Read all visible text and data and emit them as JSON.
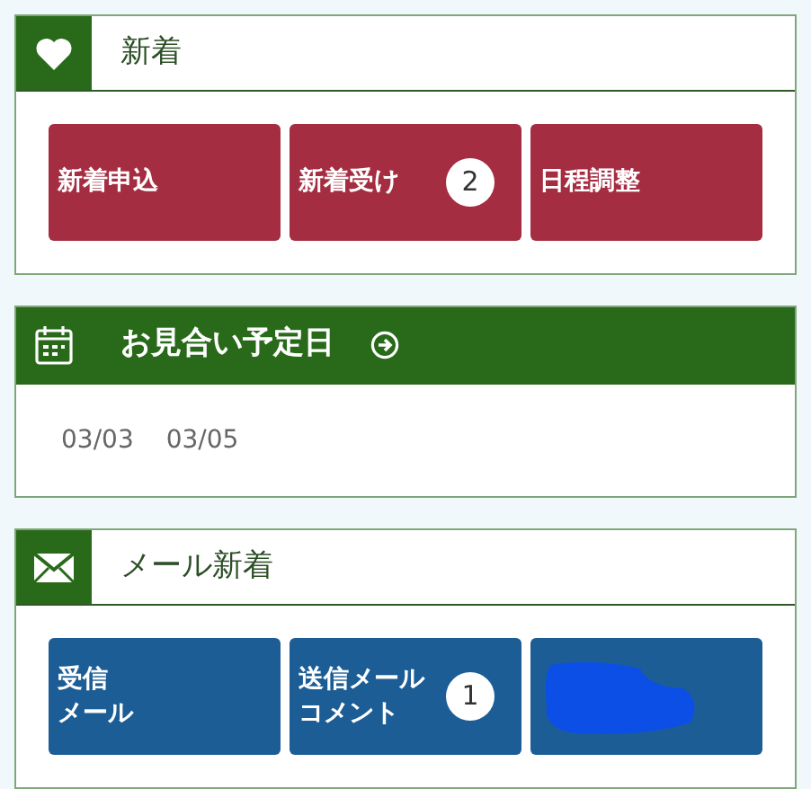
{
  "sections": [
    {
      "kind": "tiles",
      "title": "新着",
      "tiles": [
        {
          "kind": "label",
          "lines": [
            "新着申込"
          ]
        },
        {
          "kind": "label",
          "lines": [
            "新着受け"
          ],
          "badge": "2"
        },
        {
          "kind": "label",
          "lines": [
            "日程調整"
          ]
        }
      ]
    },
    {
      "kind": "dates",
      "title": "お見合い予定日",
      "dates": [
        "03/03",
        "03/05"
      ]
    },
    {
      "kind": "tiles",
      "title": "メール新着",
      "tiles": [
        {
          "kind": "label",
          "lines": [
            "受信",
            "メール"
          ]
        },
        {
          "kind": "label",
          "lines": [
            "送信メール",
            "コメント"
          ],
          "badge": "1"
        },
        {
          "kind": "redacted"
        }
      ]
    }
  ]
}
